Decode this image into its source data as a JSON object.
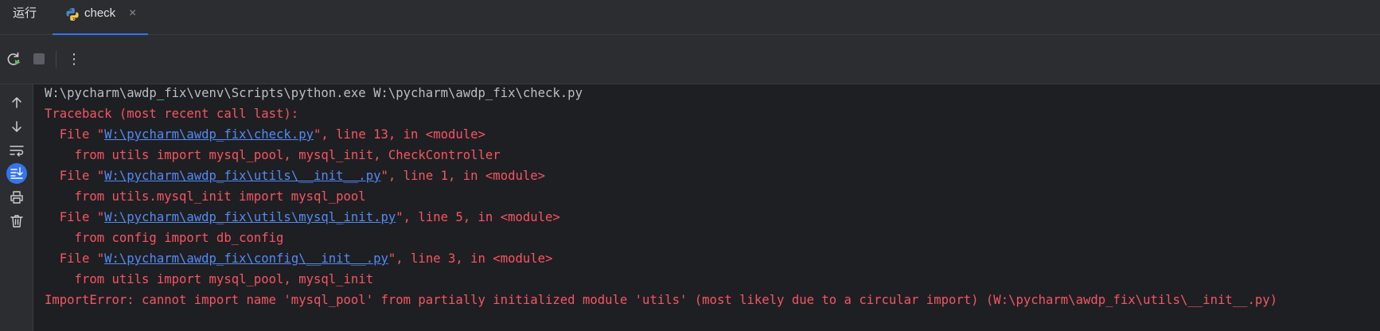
{
  "tabbar": {
    "run_label": "运行",
    "tab": {
      "title": "check",
      "close_glyph": "×",
      "icon": "python-icon"
    }
  },
  "toolbar": {
    "rerun_icon": "rerun-icon",
    "stop_icon": "stop-icon",
    "more_glyph": "⋮"
  },
  "gutter": {
    "icons": [
      "arrow-up-icon",
      "arrow-down-icon",
      "soft-wrap-icon",
      "scroll-to-end-icon",
      "print-icon",
      "trash-icon"
    ]
  },
  "console": {
    "command": "W:\\pycharm\\awdp_fix\\venv\\Scripts\\python.exe W:\\pycharm\\awdp_fix\\check.py",
    "traceback_header": "Traceback (most recent call last):",
    "frames": [
      {
        "prefix": "  File \"",
        "path": "W:\\pycharm\\awdp_fix\\check.py",
        "suffix": "\", line 13, in <module>",
        "code": "    from utils import mysql_pool, mysql_init, CheckController"
      },
      {
        "prefix": "  File \"",
        "path": "W:\\pycharm\\awdp_fix\\utils\\__init__.py",
        "suffix": "\", line 1, in <module>",
        "code": "    from utils.mysql_init import mysql_pool"
      },
      {
        "prefix": "  File \"",
        "path": "W:\\pycharm\\awdp_fix\\utils\\mysql_init.py",
        "suffix": "\", line 5, in <module>",
        "code": "    from config import db_config"
      },
      {
        "prefix": "  File \"",
        "path": "W:\\pycharm\\awdp_fix\\config\\__init__.py",
        "suffix": "\", line 3, in <module>",
        "code": "    from utils import mysql_pool, mysql_init"
      }
    ],
    "error": "ImportError: cannot import name 'mysql_pool' from partially initialized module 'utils' (most likely due to a circular import) (W:\\pycharm\\awdp_fix\\utils\\__init__.py)"
  },
  "colors": {
    "background": "#1e1f22",
    "panel": "#2b2d30",
    "accent": "#3574f0",
    "error_text": "#f75464",
    "link_text": "#548af7"
  }
}
